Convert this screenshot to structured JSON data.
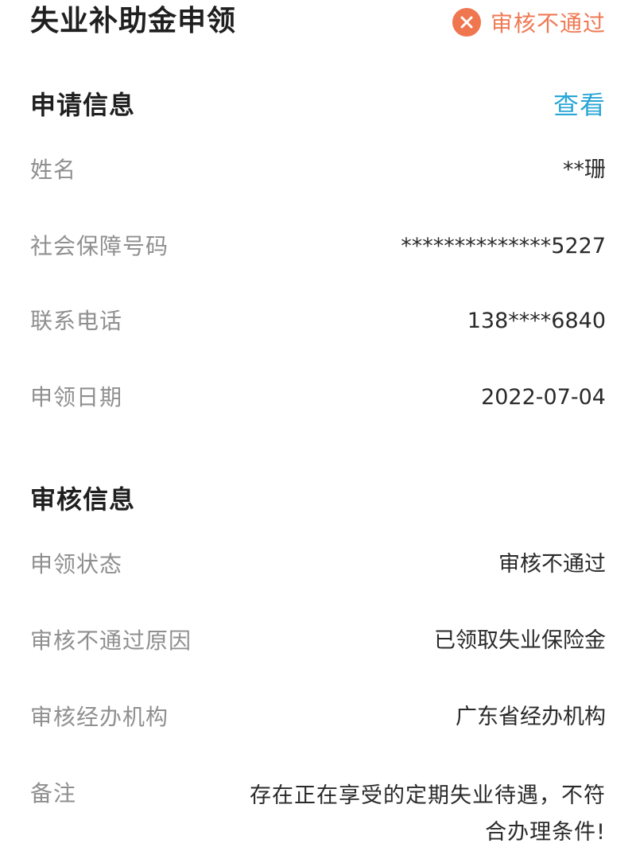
{
  "header": {
    "title": "失业补助金申领",
    "status_text": "审核不通过",
    "status_icon": "close-circle-icon",
    "status_color": "#f0764f"
  },
  "application": {
    "section_title": "申请信息",
    "view_link": "查看",
    "rows": [
      {
        "label": "姓名",
        "value": "**珊"
      },
      {
        "label": "社会保障号码",
        "value": "**************5227"
      },
      {
        "label": "联系电话",
        "value": "138****6840"
      },
      {
        "label": "申领日期",
        "value": "2022-07-04"
      }
    ]
  },
  "review": {
    "section_title": "审核信息",
    "rows": [
      {
        "label": "申领状态",
        "value": "审核不通过"
      },
      {
        "label": "审核不通过原因",
        "value": "已领取失业保险金"
      },
      {
        "label": "审核经办机构",
        "value": "广东省经办机构"
      },
      {
        "label": "备注",
        "value": "存在正在享受的定期失业待遇，不符合办理条件!"
      }
    ]
  },
  "colors": {
    "accent_link": "#2aa6d6",
    "status_red": "#ef7a55"
  }
}
